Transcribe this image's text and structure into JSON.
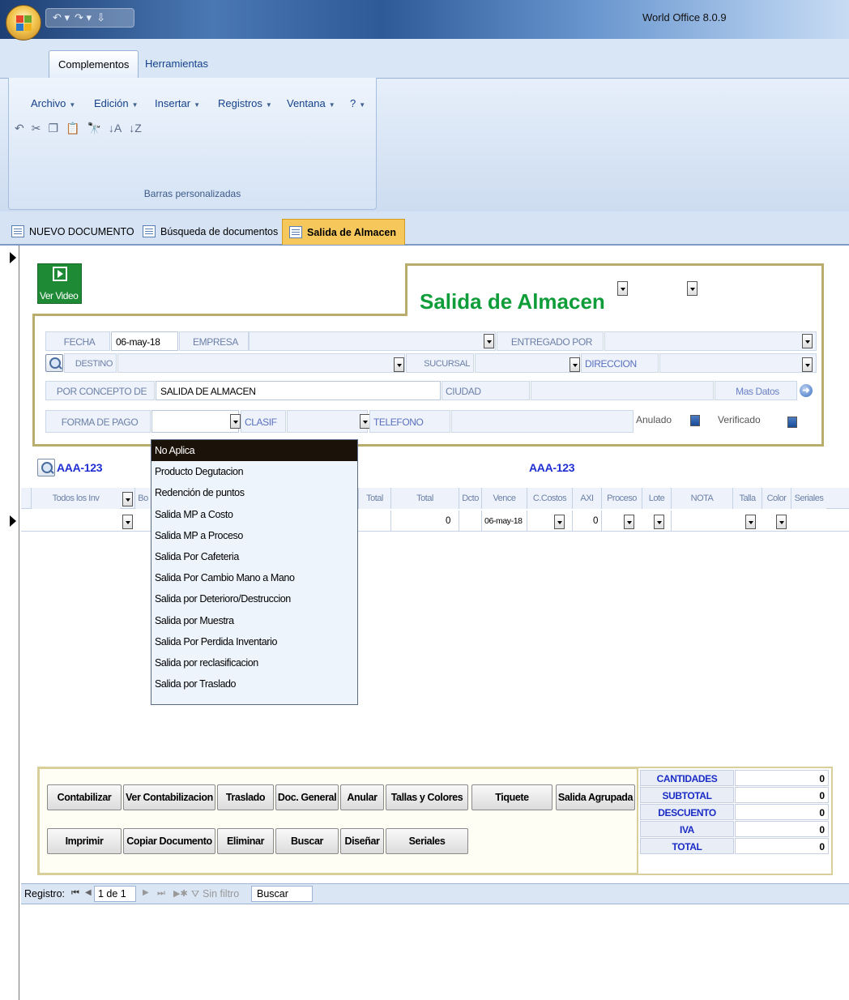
{
  "app": {
    "title": "World Office 8.0.9"
  },
  "ribbon": {
    "tabs": [
      "Complementos",
      "Herramientas"
    ],
    "menus": [
      "Archivo",
      "Edición",
      "Insertar",
      "Registros",
      "Ventana",
      "?"
    ],
    "group_label": "Barras personalizadas"
  },
  "doc_tabs": [
    "NUEVO DOCUMENTO",
    "Búsqueda de documentos",
    "Salida de Almacen"
  ],
  "video": {
    "label": "Ver Video"
  },
  "form": {
    "title": "Salida de Almacen",
    "fecha_label": "FECHA",
    "fecha_value": "06-may-18",
    "empresa_label": "EMPRESA",
    "entregado_label": "ENTREGADO POR",
    "destino_label": "DESTINO",
    "sucursal_label": "SUCURSAL",
    "direccion_label": "DIRECCION",
    "concepto_label": "POR CONCEPTO DE",
    "concepto_value": "SALIDA DE ALMACEN",
    "ciudad_label": "CIUDAD",
    "mas_datos": "Mas Datos",
    "forma_pago_label": "FORMA DE PAGO",
    "clasif_label": "CLASIF",
    "telefono_label": "TELEFONO",
    "anulado_label": "Anulado",
    "verificado_label": "Verificado"
  },
  "grid": {
    "code_left": "AAA-123",
    "code_center": "AAA-123",
    "columns": [
      "Todos los Inv",
      "Bo",
      "Total",
      "Total",
      "Dcto",
      "Vence",
      "C.Costos",
      "AXI",
      "Proceso",
      "Lote",
      "NOTA",
      "Talla",
      "Color",
      "Seriales"
    ],
    "row": {
      "total": "0",
      "vence": "06-may-18",
      "axi": "0"
    }
  },
  "dropdown": {
    "options": [
      "No Aplica",
      "Producto Degutacion",
      "Redención de puntos",
      "Salida MP a Costo",
      "Salida MP a Proceso",
      "Salida Por Cafeteria",
      "Salida Por Cambio Mano a Mano",
      "Salida por Deterioro/Destruccion",
      "Salida por Muestra",
      "Salida Por Perdida Inventario",
      "Salida por reclasificacion",
      "Salida por Traslado"
    ],
    "selected_index": 0
  },
  "buttons": {
    "row1": [
      "Contabilizar",
      "Ver Contabilizacion",
      "Traslado",
      "Doc. General",
      "Anular",
      "Tallas y Colores",
      "Tiquete",
      "Salida Agrupada"
    ],
    "row2": [
      "Imprimir",
      "Copiar Documento",
      "Eliminar",
      "Buscar",
      "Diseñar",
      "Seriales"
    ]
  },
  "totals": [
    {
      "label": "CANTIDADES",
      "value": "0"
    },
    {
      "label": "SUBTOTAL",
      "value": "0"
    },
    {
      "label": "DESCUENTO",
      "value": "0"
    },
    {
      "label": "IVA",
      "value": "0"
    },
    {
      "label": "TOTAL",
      "value": "0"
    }
  ],
  "record_nav": {
    "label": "Registro:",
    "position": "1 de 1",
    "filter": "Sin filtro",
    "search": "Buscar"
  },
  "colors": {
    "title_green": "#0f9d3a",
    "code_blue": "#1f2fd1",
    "active_tab": "#f6c85c"
  }
}
